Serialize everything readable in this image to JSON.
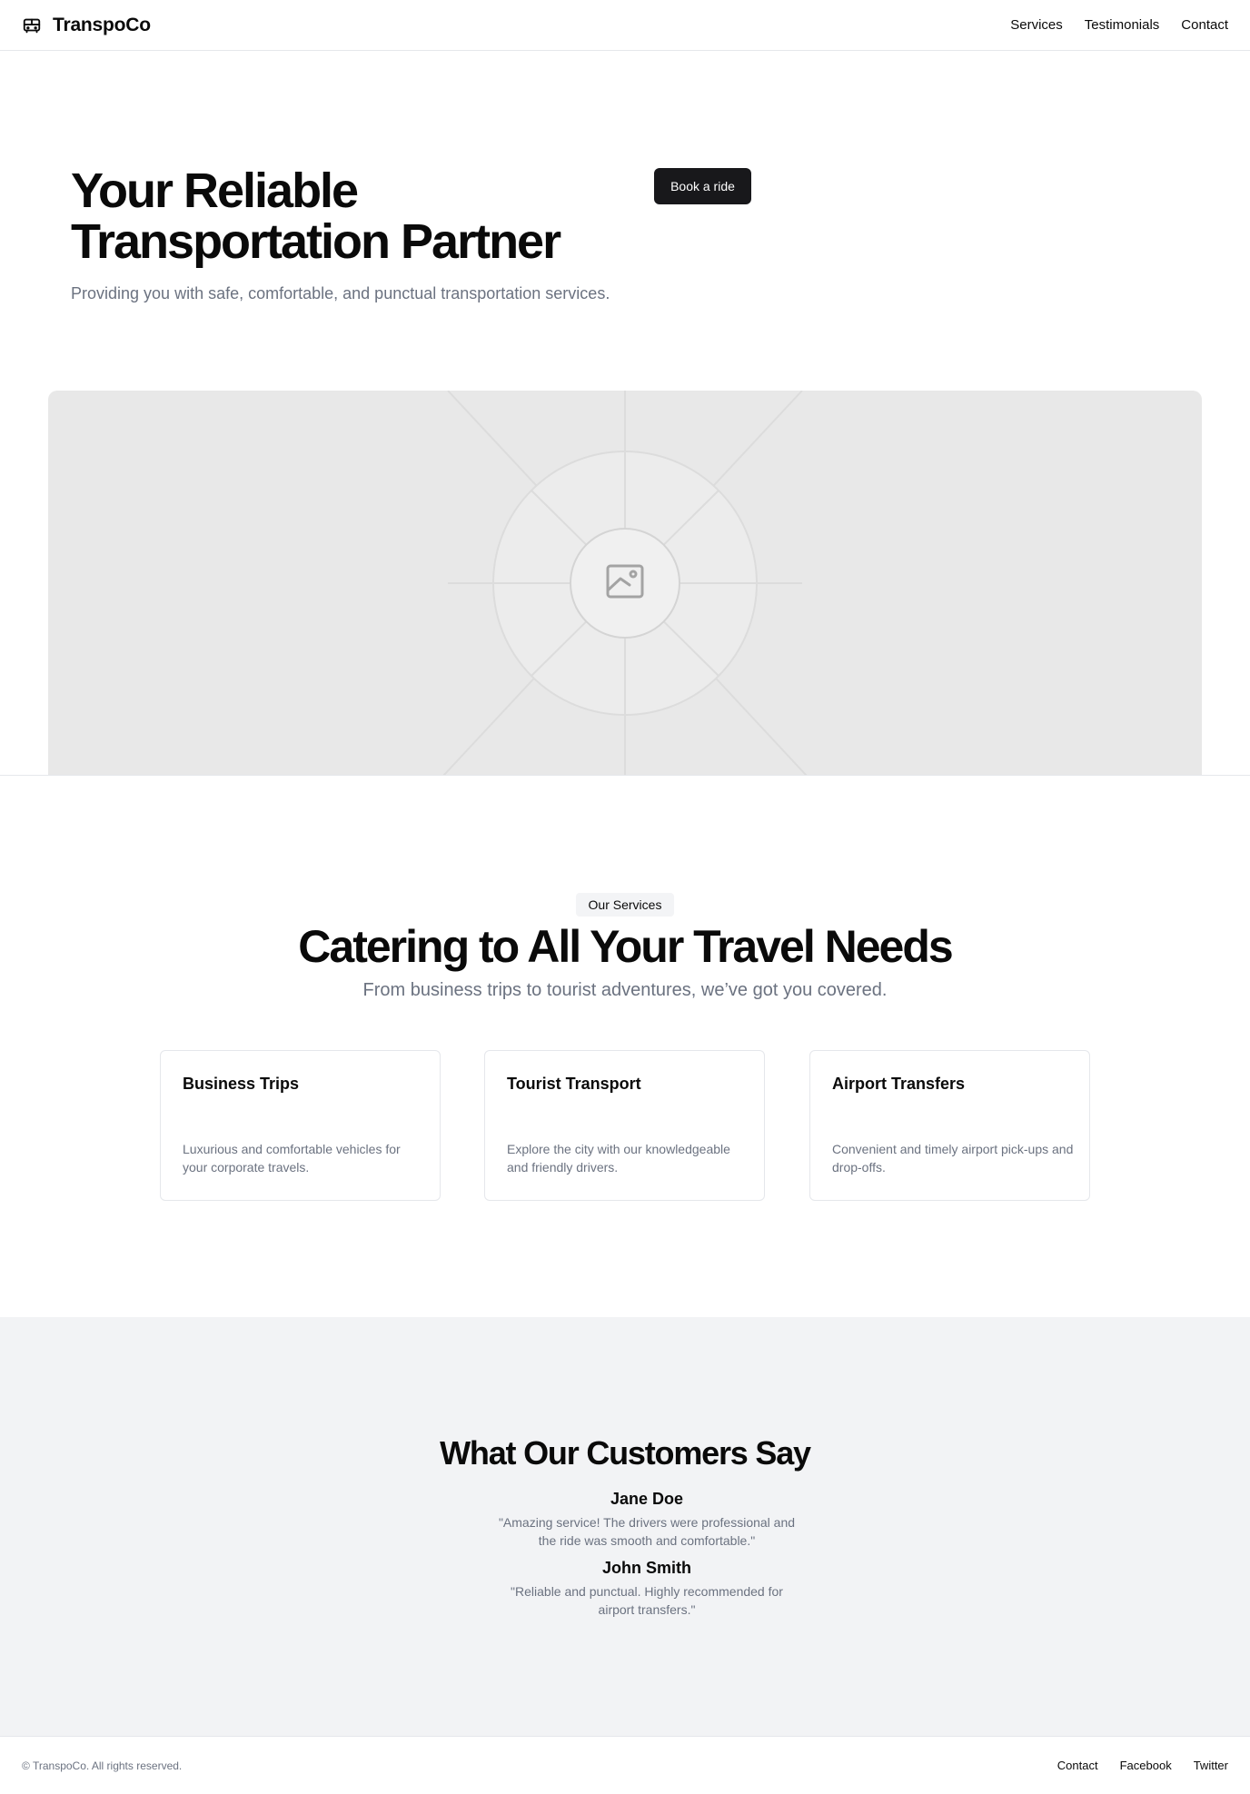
{
  "header": {
    "brand": "TranspoCo",
    "brand_icon": "bus-icon",
    "nav": [
      "Services",
      "Testimonials",
      "Contact"
    ]
  },
  "hero": {
    "title": "Your Reliable Transportation Partner",
    "subtitle": "Providing you with safe, comfortable, and punctual transportation services.",
    "cta_label": "Book a ride",
    "image_icon": "image-placeholder-icon"
  },
  "services": {
    "badge": "Our Services",
    "title": "Catering to All Your Travel Needs",
    "subtitle": "From business trips to tourist adventures, we’ve got you covered.",
    "cards": [
      {
        "title": "Business Trips",
        "desc": "Luxurious and comfortable vehicles for your corporate travels."
      },
      {
        "title": "Tourist Transport",
        "desc": "Explore the city with our knowledgeable and friendly drivers."
      },
      {
        "title": "Airport Transfers",
        "desc": "Convenient and timely airport pick-ups and drop-offs."
      }
    ]
  },
  "testimonials": {
    "title": "What Our Customers Say",
    "items": [
      {
        "name": "Jane Doe",
        "quote": "\"Amazing service! The drivers were professional and the ride was smooth and comfortable.\""
      },
      {
        "name": "John Smith",
        "quote": "\"Reliable and punctual. Highly recommended for airport transfers.\""
      }
    ]
  },
  "footer": {
    "copyright": "© TranspoCo. All rights reserved.",
    "links": [
      "Contact",
      "Facebook",
      "Twitter"
    ]
  },
  "colors": {
    "primary_button": "#18181b",
    "muted_text": "#6b7280",
    "section_bg": "#f2f3f5",
    "placeholder_bg": "#e8e8e8"
  }
}
